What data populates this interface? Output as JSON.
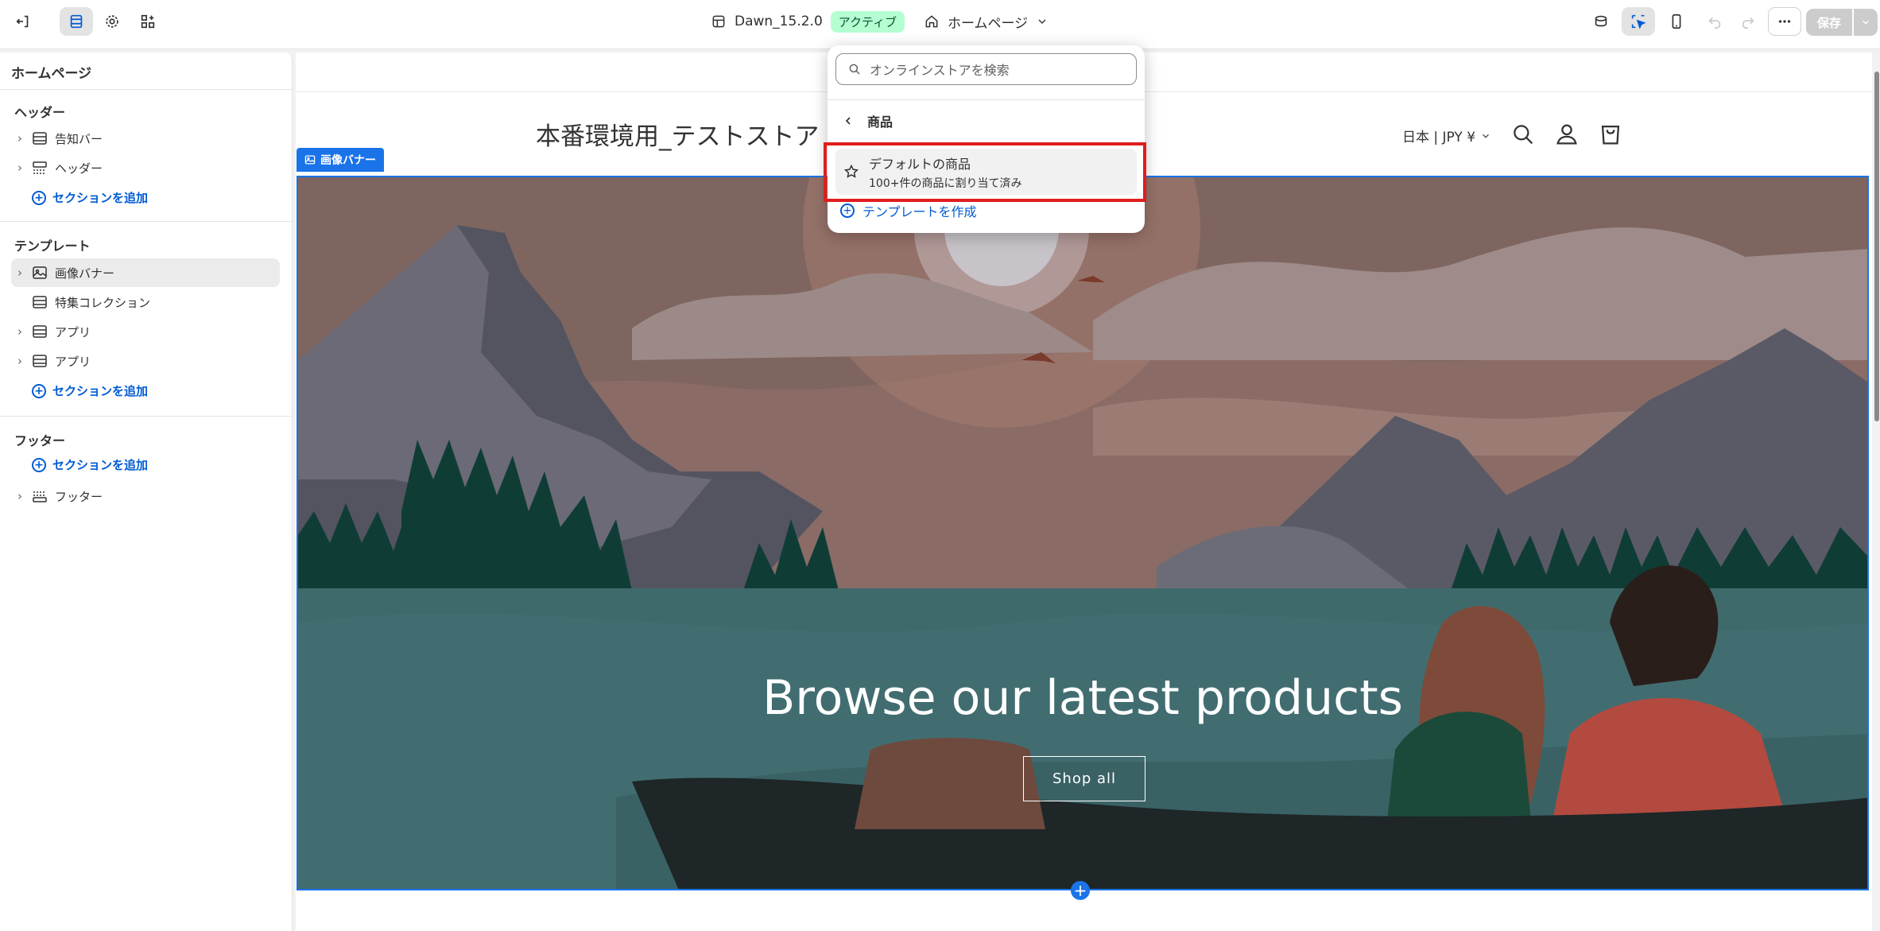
{
  "topbar": {
    "theme_name": "Dawn_15.2.0",
    "theme_status": "アクティブ",
    "template_selector": "ホームページ",
    "save_label": "保存"
  },
  "sidebar": {
    "title": "ホームページ",
    "header_group": "ヘッダー",
    "header_items": [
      "告知バー",
      "ヘッダー"
    ],
    "add_section": "セクションを追加",
    "template_group": "テンプレート",
    "template_items": [
      "画像バナー",
      "特集コレクション",
      "アプリ",
      "アプリ"
    ],
    "footer_group": "フッター",
    "footer_items": [
      "フッター"
    ]
  },
  "preview": {
    "store_name": "本番環境用_テストストア",
    "country": "日本 | JPY ¥",
    "banner_tag": "画像バナー",
    "banner_heading": "Browse our latest products",
    "banner_button": "Shop all"
  },
  "popover": {
    "search_placeholder": "オンラインストアを検索",
    "back_label": "商品",
    "option_title": "デフォルトの商品",
    "option_subtitle": "100+件の商品に割り当て済み",
    "create_label": "テンプレートを作成"
  },
  "colors": {
    "accent": "#005bd3",
    "selection": "#1a73e8",
    "highlight": "#e01d1d",
    "badge_bg": "#b4fed2"
  }
}
